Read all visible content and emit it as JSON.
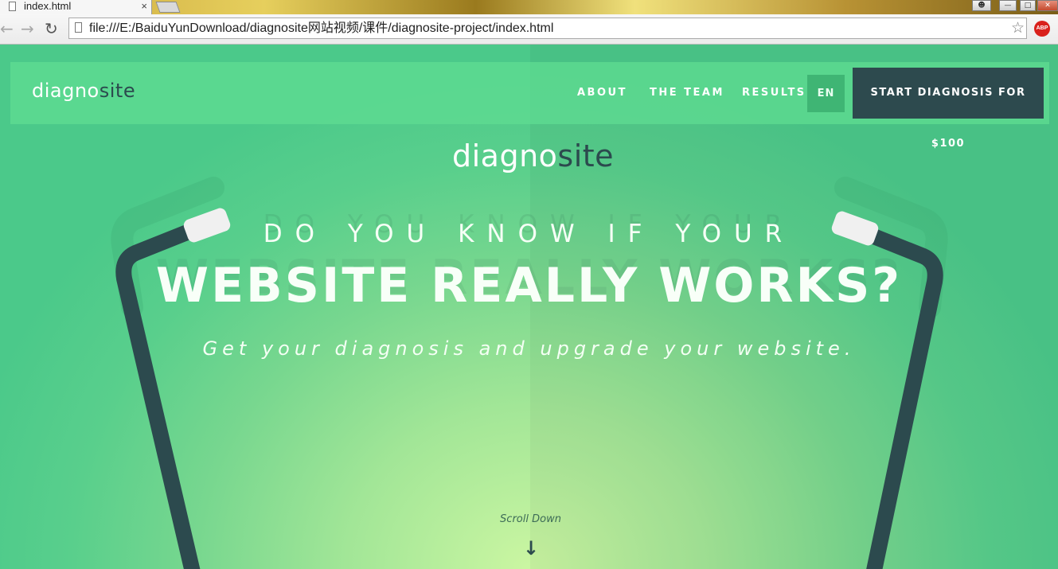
{
  "browser": {
    "tab_title": "index.html",
    "tab_close": "×",
    "url": "file:///E:/BaiduYunDownload/diagnosite网站视频/课件/diagnosite-project/index.html",
    "adblock_label": "ABP",
    "icons": {
      "back": "arrow-left",
      "forward": "arrow-right",
      "reload": "reload",
      "bookmark": "star",
      "page": "document"
    }
  },
  "site": {
    "logo": {
      "light_part": "diagno",
      "dark_part": "site"
    },
    "nav": {
      "items": [
        "ABOUT",
        "THE TEAM",
        "RESULTS"
      ],
      "language": "EN",
      "cta": "START DIAGNOSIS FOR $100"
    },
    "hero": {
      "logo": {
        "light_part": "diagno",
        "dark_part": "site"
      },
      "headline_line1": "DO YOU KNOW IF YOUR",
      "headline_line2": "WEBSITE REALLY WORKS?",
      "tagline": "Get your diagnosis and upgrade your website.",
      "scroll_text": "Scroll Down",
      "scroll_arrow": "↓"
    }
  },
  "colors": {
    "dark_teal": "#2c4a4e",
    "green_button": "#3fb574",
    "navbar_green": "#5fdc91",
    "glow": "#cbf6a2",
    "adblock_red": "#d9211c"
  }
}
